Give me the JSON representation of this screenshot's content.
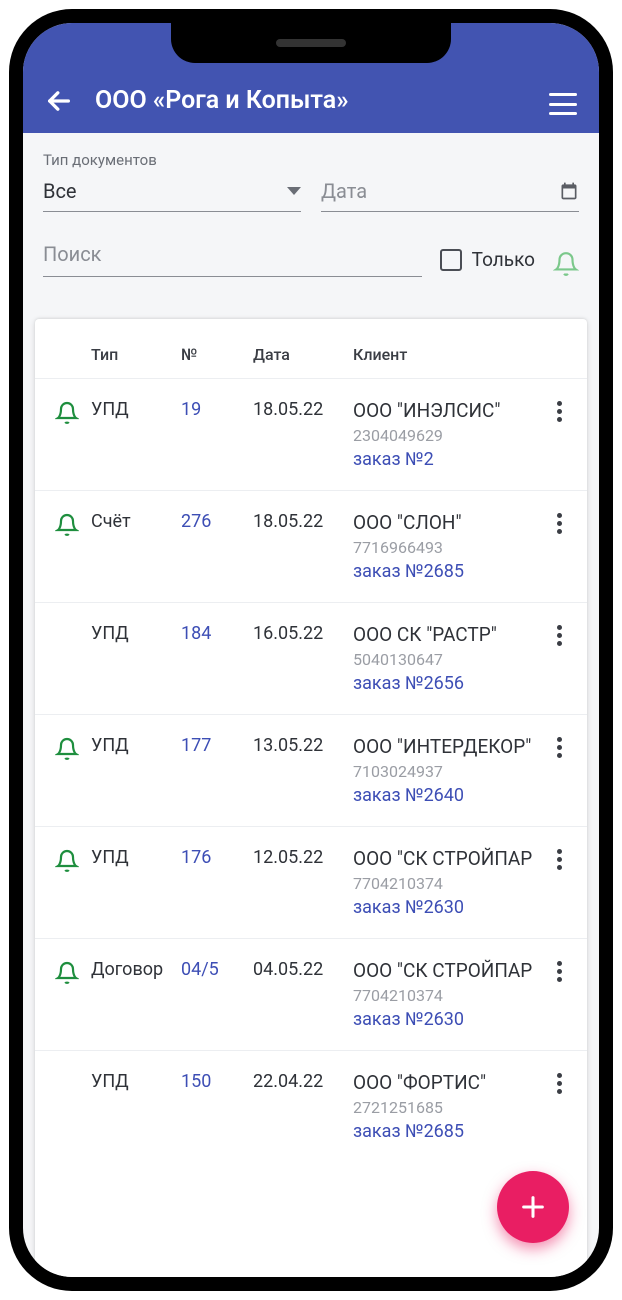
{
  "header": {
    "title": "ООО «Рога и Копыта»"
  },
  "filters": {
    "doc_type_label": "Тип документов",
    "doc_type_value": "Все",
    "date_placeholder": "Дата",
    "search_placeholder": "Поиск",
    "only_label": "Только"
  },
  "table": {
    "headers": {
      "type": "Тип",
      "num": "№",
      "date": "Дата",
      "client": "Клиент"
    },
    "rows": [
      {
        "bell": true,
        "type": "УПД",
        "num": "19",
        "date": "18.05.22",
        "client": "ООО \"ИНЭЛСИС\"",
        "inn": "2304049629",
        "order": "заказ №2"
      },
      {
        "bell": true,
        "type": "Счёт",
        "num": "276",
        "date": "18.05.22",
        "client": "ООО \"СЛОН\"",
        "inn": "7716966493",
        "order": "заказ №2685"
      },
      {
        "bell": false,
        "type": "УПД",
        "num": "184",
        "date": "16.05.22",
        "client": "ООО СК \"РАСТР\"",
        "inn": "5040130647",
        "order": "заказ №2656"
      },
      {
        "bell": true,
        "type": "УПД",
        "num": "177",
        "date": "13.05.22",
        "client": "ООО \"ИНТЕРДЕКОР\"",
        "inn": "7103024937",
        "order": "заказ №2640"
      },
      {
        "bell": true,
        "type": "УПД",
        "num": "176",
        "date": "12.05.22",
        "client": "ООО \"СК СТРОЙПАР",
        "inn": "7704210374",
        "order": "заказ №2630"
      },
      {
        "bell": true,
        "type": "Договор",
        "num": "04/5",
        "date": "04.05.22",
        "client": "ООО \"СК СТРОЙПАР",
        "inn": "7704210374",
        "order": "заказ №2630"
      },
      {
        "bell": false,
        "type": "УПД",
        "num": "150",
        "date": "22.04.22",
        "client": "ООО \"ФОРТИС\"",
        "inn": "2721251685",
        "order": "заказ №2685"
      }
    ]
  }
}
